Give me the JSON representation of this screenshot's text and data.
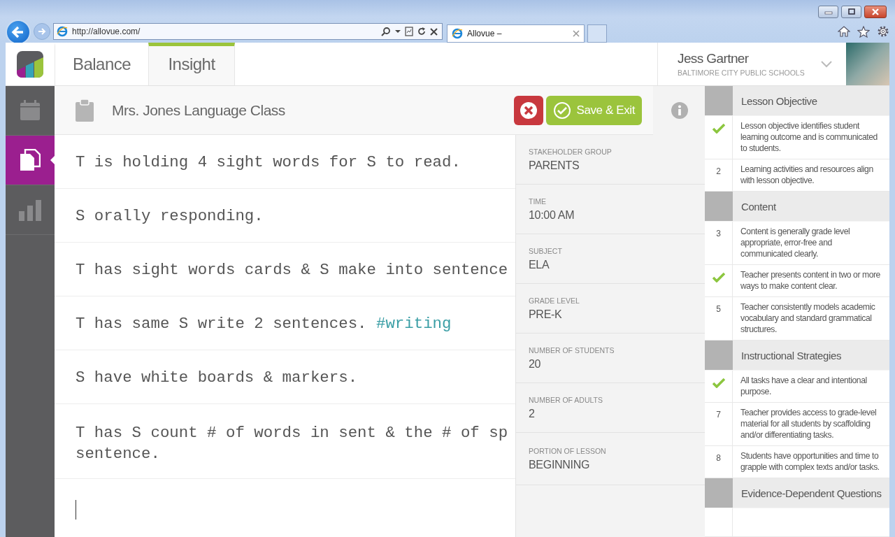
{
  "browser": {
    "address": "http://allovue.com/",
    "tab_title": "Allovue –"
  },
  "nav_tabs": [
    {
      "label": "Balance",
      "selected": false
    },
    {
      "label": "Insight",
      "selected": true
    }
  ],
  "user": {
    "name": "Jess Gartner",
    "organization": "BALTIMORE CITY PUBLIC SCHOOLS"
  },
  "sidebar": {
    "items": [
      {
        "kind": "calendar",
        "selected": false
      },
      {
        "kind": "document",
        "selected": true
      },
      {
        "kind": "chart",
        "selected": false
      }
    ]
  },
  "session": {
    "title": "Mrs. Jones Language Class",
    "save_label": "Save & Exit"
  },
  "notes": [
    {
      "lines": [
        "T is holding 4 sight words for S to read."
      ]
    },
    {
      "lines": [
        "S orally responding."
      ]
    },
    {
      "lines": [
        "T has sight words cards & S make into sentence"
      ]
    },
    {
      "lines": [
        "T has same S write 2 sentences."
      ],
      "tag": "#writing"
    },
    {
      "lines": [
        "S have white boards & markers."
      ]
    },
    {
      "lines": [
        "T has S count # of words in sent & the # of sp",
        "sentence."
      ]
    }
  ],
  "details": [
    {
      "label": "STAKEHOLDER GROUP",
      "value": "PARENTS"
    },
    {
      "label": "TIME",
      "value": "10:00 AM"
    },
    {
      "label": "SUBJECT",
      "value": "ELA"
    },
    {
      "label": "GRADE LEVEL",
      "value": "PRE-K"
    },
    {
      "label": "NUMBER OF STUDENTS",
      "value": "20"
    },
    {
      "label": "NUMBER OF ADULTS",
      "value": "2"
    },
    {
      "label": "PORTION OF LESSON",
      "value": "BEGINNING"
    }
  ],
  "rubric": [
    {
      "kind": "section",
      "title": "Lesson Objective"
    },
    {
      "kind": "criterion",
      "checked": true,
      "text": "Lesson objective identifies student learning outcome and is communicated to students."
    },
    {
      "kind": "criterion",
      "checked": false,
      "number": "2",
      "text": "Learning activities and resources align with lesson objective."
    },
    {
      "kind": "section",
      "title": "Content"
    },
    {
      "kind": "criterion",
      "checked": false,
      "number": "3",
      "text": "Content is generally grade level appropriate, error-free and communicated clearly."
    },
    {
      "kind": "criterion",
      "checked": true,
      "text": "Teacher presents content in two or more ways to make content clear."
    },
    {
      "kind": "criterion",
      "checked": false,
      "number": "5",
      "text": "Teacher consistently models academic vocabulary and standard grammatical structures."
    },
    {
      "kind": "section",
      "title": "Instructional Strategies"
    },
    {
      "kind": "criterion",
      "checked": true,
      "text": "All tasks have a clear and intentional purpose."
    },
    {
      "kind": "criterion",
      "checked": false,
      "number": "7",
      "text": "Teacher provides access to grade-level material for all students by scaffolding and/or differentiating tasks."
    },
    {
      "kind": "criterion",
      "checked": false,
      "number": "8",
      "text": "Students have opportunities and time to grapple with complex texts and/or tasks."
    },
    {
      "kind": "section",
      "title": "Evidence-Dependent Questions"
    }
  ]
}
